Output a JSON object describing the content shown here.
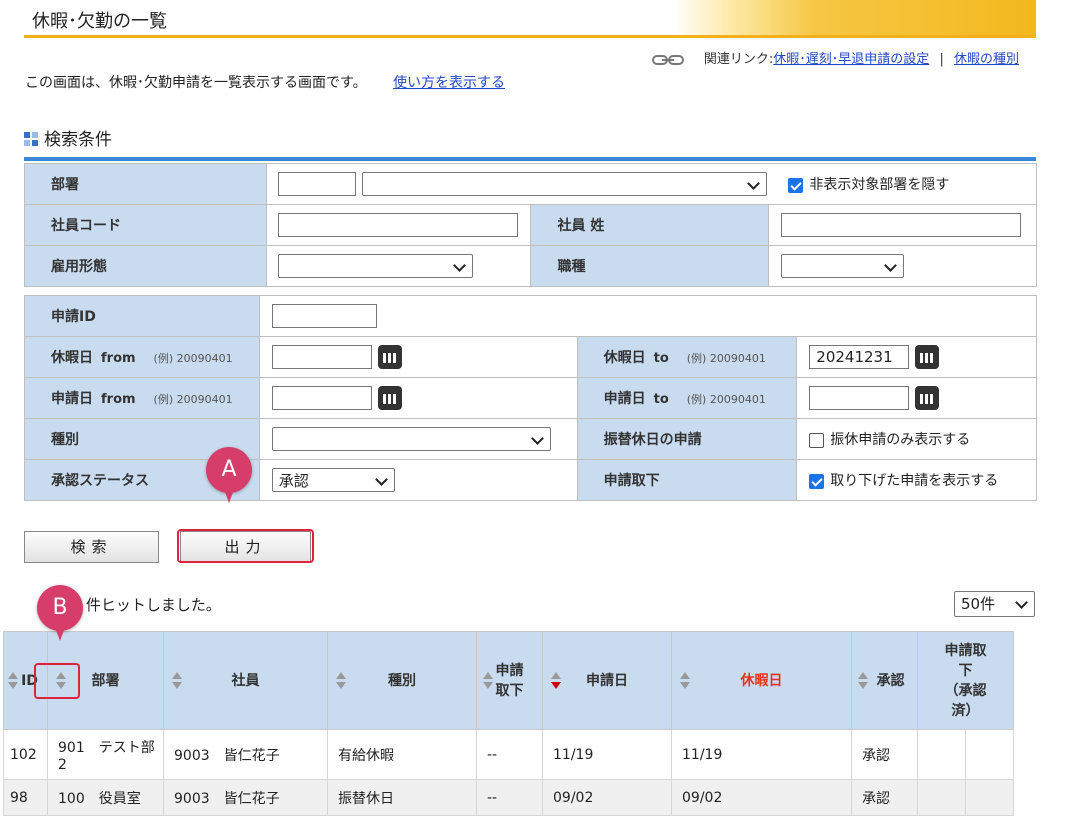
{
  "header": {
    "title": "休暇･欠勤の一覧",
    "related_prefix": "関連リンク:",
    "related_links": [
      "休暇･遅刻･早退申請の設定",
      "休暇の種別"
    ],
    "related_sep": "|",
    "description": "この画面は、休暇･欠勤申請を一覧表示する画面です。",
    "howto_link": "使い方を表示する"
  },
  "search": {
    "section_title": "検索条件",
    "labels": {
      "department": "部署",
      "employee_code": "社員コード",
      "employee_surname": "社員 姓",
      "employment_type": "雇用形態",
      "job_type": "職種",
      "request_id": "申請ID",
      "leave_from": "休暇日",
      "leave_to": "休暇日",
      "apply_from": "申請日",
      "apply_to": "申請日",
      "from": "from",
      "to": "to",
      "example": "(例) 20090401",
      "kind": "種別",
      "substitute": "振替休日の申請",
      "approval_status": "承認ステータス",
      "withdrawal": "申請取下"
    },
    "hide_dept_label": "非表示対象部署を隠す",
    "leave_to_value": "20241231",
    "substitute_only_label": "振休申請のみ表示する",
    "approval_status_value": "承認",
    "show_withdrawn_label": "取り下げた申請を表示する"
  },
  "buttons": {
    "search": "検索",
    "output": "出力"
  },
  "annotations": {
    "a": "A",
    "b": "B"
  },
  "results": {
    "hits_text": "40 件ヒットしました。",
    "page_size": "50件",
    "columns": [
      "ID",
      "部署",
      "社員",
      "種別",
      "申請取下",
      "申請日",
      "休暇日",
      "承認",
      "申請取下（承認済）"
    ],
    "column_lines": {
      "withdraw": [
        "申請",
        "取下"
      ],
      "withdraw_approved": [
        "申請取",
        "下",
        "（承認",
        "済）"
      ]
    },
    "rows": [
      {
        "id": "102",
        "dept": "901　テスト部2",
        "employee": "9003　皆仁花子",
        "kind": "有給休暇",
        "withdraw": "--",
        "apply_date": "11/19",
        "leave_date": "11/19",
        "approval": "承認"
      },
      {
        "id": "98",
        "dept": "100　役員室",
        "employee": "9003　皆仁花子",
        "kind": "振替休日",
        "withdraw": "--",
        "apply_date": "09/02",
        "leave_date": "09/02",
        "approval": "承認"
      }
    ]
  },
  "colors": {
    "accent": "#3a86d8",
    "label_bg": "#c9dbef",
    "highlight": "#e0233c",
    "pin": "#d63d6a",
    "title_bar": "#f2b11b"
  }
}
